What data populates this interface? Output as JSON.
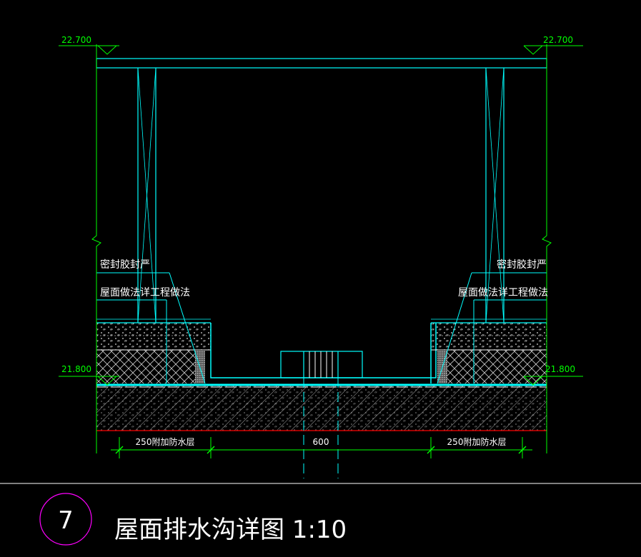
{
  "drawing": {
    "elevations": {
      "top_left": "22.700",
      "top_right": "22.700",
      "bottom_left": "21.800",
      "bottom_right": "21.800"
    },
    "annotations": {
      "sealant_left": "密封胶封严",
      "sealant_right": "密封胶封严",
      "roof_left": "屋面做法详工程做法",
      "roof_right": "屋面做法详工程做法"
    },
    "dimensions": {
      "left": "250附加防水层",
      "center": "600",
      "right": "250附加防水层"
    },
    "title_block": {
      "number": "7",
      "title": "屋面排水沟详图 1:10"
    },
    "colors": {
      "background": "#000000",
      "structure": "#00ffff",
      "dimension": "#00ff00",
      "text": "#ffffff",
      "title_circle": "#ff00ff",
      "base_line": "#ff0000"
    }
  }
}
